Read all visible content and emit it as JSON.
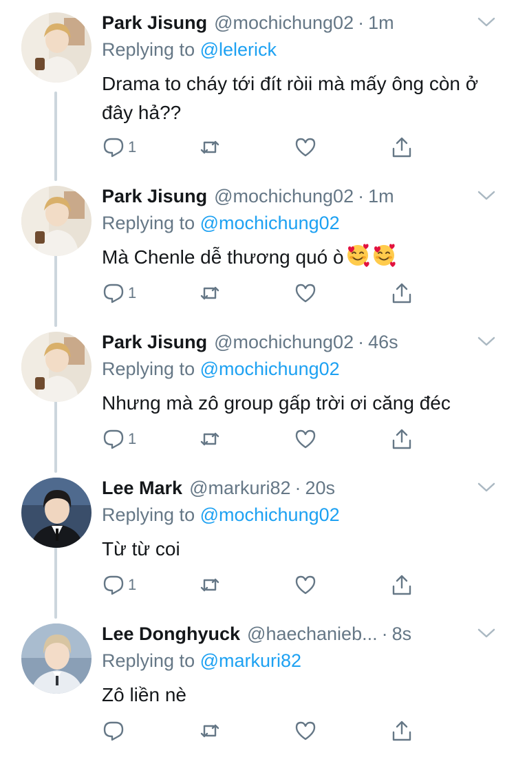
{
  "colors": {
    "accent": "#1da1f2",
    "secondary": "#657786",
    "thread": "#ccd6dd",
    "text": "#14171a"
  },
  "tweets": [
    {
      "name": "Park Jisung",
      "handle": "@mochichung02",
      "dot": "·",
      "time": "1m",
      "replying_label": "Replying to",
      "replying_to": "@lelerick",
      "text": "Drama to cháy tới đít ròii mà mấy ông còn ở đây hả??",
      "reply_count": "1",
      "emojis": []
    },
    {
      "name": "Park Jisung",
      "handle": "@mochichung02",
      "dot": "·",
      "time": "1m",
      "replying_label": "Replying to",
      "replying_to": "@mochichung02",
      "text": "Mà Chenle dễ thương quó ò",
      "reply_count": "1",
      "emojis": [
        "smiling-face-with-hearts",
        "smiling-face-with-hearts"
      ]
    },
    {
      "name": "Park Jisung",
      "handle": "@mochichung02",
      "dot": "·",
      "time": "46s",
      "replying_label": "Replying to",
      "replying_to": "@mochichung02",
      "text": "Nhưng mà zô group gấp trời ơi căng đéc",
      "reply_count": "1",
      "emojis": []
    },
    {
      "name": "Lee Mark",
      "handle": "@markuri82",
      "dot": "·",
      "time": "20s",
      "replying_label": "Replying to",
      "replying_to": "@mochichung02",
      "text": "Từ từ coi",
      "reply_count": "1",
      "emojis": []
    },
    {
      "name": "Lee Donghyuck",
      "handle": "@haechanieb...",
      "dot": "·",
      "time": "8s",
      "replying_label": "Replying to",
      "replying_to": "@markuri82",
      "text": "Zô liền nè",
      "reply_count": "",
      "emojis": []
    }
  ],
  "icons": {
    "reply": "reply-icon",
    "retweet": "retweet-icon",
    "like": "heart-icon",
    "share": "share-icon",
    "more": "chevron-down-icon"
  }
}
